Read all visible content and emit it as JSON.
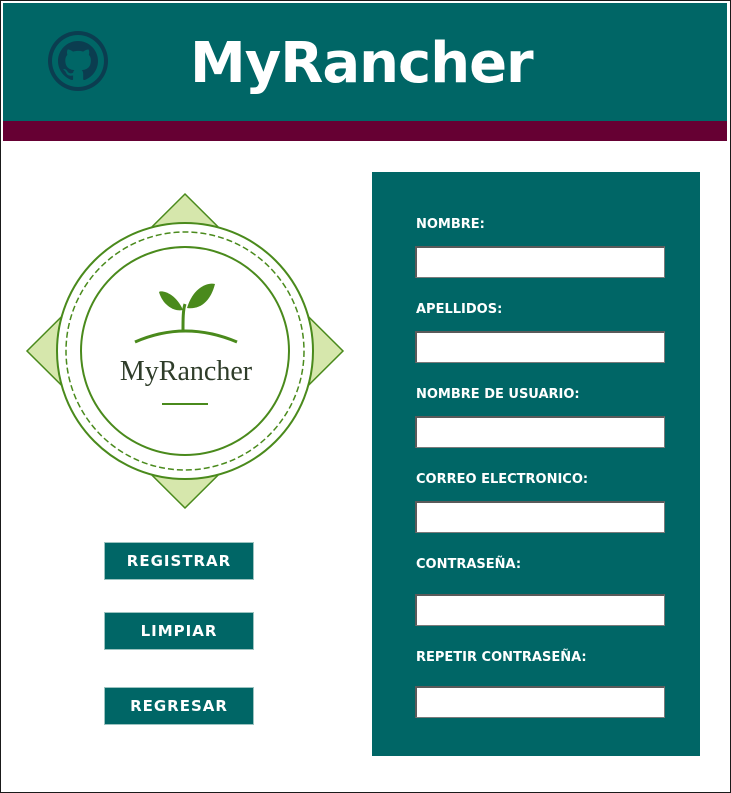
{
  "header": {
    "title": "MyRancher",
    "github_icon": "github-icon"
  },
  "logo": {
    "text": "MyRancher",
    "icon": "sprout-icon"
  },
  "buttons": {
    "register": "REGISTRAR",
    "clear": "LIMPIAR",
    "back": "REGRESAR"
  },
  "form": {
    "fields": [
      {
        "label": "NOMBRE:",
        "value": ""
      },
      {
        "label": "APELLIDOS:",
        "value": ""
      },
      {
        "label": "NOMBRE DE USUARIO:",
        "value": ""
      },
      {
        "label": "CORREO ELECTRONICO:",
        "value": ""
      },
      {
        "label": "CONTRASEÑA:",
        "value": ""
      },
      {
        "label": "REPETIR CONTRASEÑA:",
        "value": ""
      }
    ]
  },
  "colors": {
    "teal": "#006666",
    "maroon": "#660033",
    "logo_green": "#4a8a1c",
    "logo_fill": "#d6e7ac"
  }
}
